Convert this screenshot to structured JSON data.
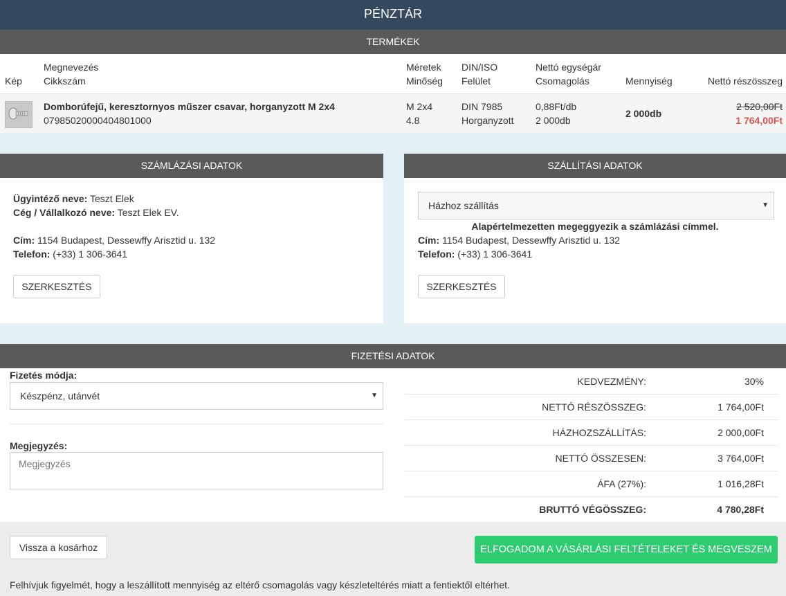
{
  "header": {
    "title": "PÉNZTÁR"
  },
  "products": {
    "section_title": "TERMÉKEK",
    "headers": {
      "kep": "Kép",
      "megnevezes": "Megnevezés",
      "cikkszam": "Cikkszám",
      "meretek": "Méretek",
      "minoseg": "Minőség",
      "din": "DIN/ISO",
      "felulet": "Felület",
      "netto_egysegar": "Nettó egységár",
      "csomagolas": "Csomagolás",
      "mennyiseg": "Mennyiség",
      "netto_reszosszeg": "Nettó részösszeg"
    },
    "items": [
      {
        "name": "Domborúfejű, keresztornyos műszer csavar, horganyzott M 2x4",
        "sku": "07985020000404801000",
        "size": "M 2x4",
        "quality": "4.8",
        "din": "DIN 7985",
        "surface": "Horganyzott",
        "unit_price": "0,88Ft/db",
        "packaging": "2 000db",
        "quantity": "2 000db",
        "old_subtotal": "2 520,00Ft",
        "subtotal": "1 764,00Ft"
      }
    ]
  },
  "billing": {
    "section_title": "SZÁMLÁZÁSI ADATOK",
    "agent_label": "Ügyintéző neve:",
    "agent_value": "Teszt Elek",
    "company_label": "Cég / Vállalkozó neve:",
    "company_value": "Teszt Elek EV.",
    "address_label": "Cím:",
    "address_value": "1154 Budapest, Dessewffy Arisztid u. 132",
    "phone_label": "Telefon:",
    "phone_value": "(+33) 1 306-3641",
    "edit_button": "SZERKESZTÉS"
  },
  "shipping": {
    "section_title": "SZÁLLÍTÁSI ADATOK",
    "method_selected": "Házhoz szállítás",
    "default_note": "Alapértelmezetten megeggyezik a számlázási címmel.",
    "address_label": "Cím:",
    "address_value": "1154 Budapest, Dessewffy Arisztid u. 132",
    "phone_label": "Telefon:",
    "phone_value": "(+33) 1 306-3641",
    "edit_button": "SZERKESZTÉS"
  },
  "payment": {
    "section_title": "FIZETÉSI ADATOK",
    "method_label": "Fizetés módja:",
    "method_selected": "Készpénz, utánvét",
    "note_label": "Megjegyzés:",
    "note_placeholder": "Megjegyzés",
    "summary": [
      {
        "label": "KEDVEZMÉNY:",
        "value": "30%"
      },
      {
        "label": "NETTÓ RÉSZÖSSZEG:",
        "value": "1 764,00Ft"
      },
      {
        "label": "HÁZHOZSZÁLLÍTÁS:",
        "value": "2 000,00Ft"
      },
      {
        "label": "NETTÓ ÖSSZESEN:",
        "value": "3 764,00Ft"
      },
      {
        "label": "ÁFA (27%):",
        "value": "1 016,28Ft"
      },
      {
        "label": "BRUTTÓ VÉGÖSSZEG:",
        "value": "4 780,28Ft"
      }
    ]
  },
  "footer": {
    "back_button": "Vissza a kosárhoz",
    "accept_button": "ELFOGADOM A VÁSÁRLÁSI FELTÉTELEKET ÉS MEGVESZEM",
    "notice": "Felhívjuk figyelmét, hogy a leszállított mennyiség az eltérő csomagolás vagy készleteltérés miatt a fentiektől eltérhet."
  },
  "colors": {
    "topbar": "#34495e",
    "section_header": "#5a5a5a",
    "background": "#e3f1f4",
    "accent_green": "#2ecc71",
    "price_red": "#d9534f"
  },
  "icons": {
    "product_thumbnail": "screw-image",
    "select_caret": "caret-down-icon"
  }
}
